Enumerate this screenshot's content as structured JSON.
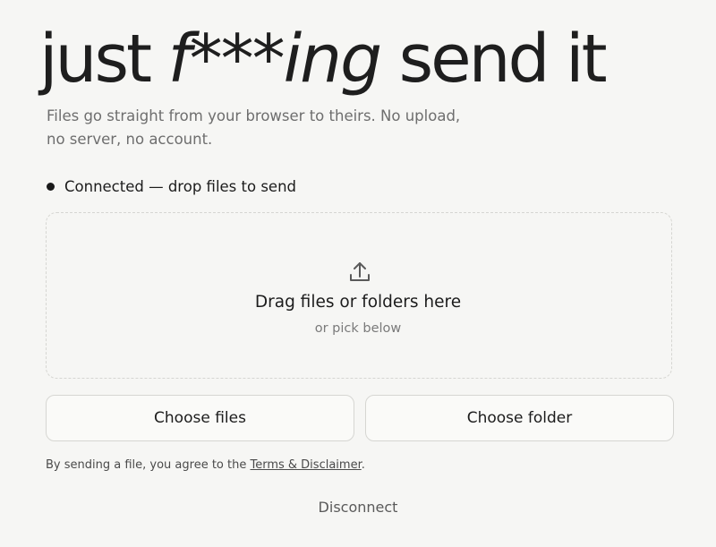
{
  "header": {
    "title_before": "just ",
    "title_em": "f***ing",
    "title_after": " send it",
    "tagline": "Files go straight from your browser to theirs. No upload, no server, no account."
  },
  "status": {
    "text": "Connected — drop files to send"
  },
  "dropzone": {
    "icon": "upload-icon",
    "heading": "Drag files or folders here",
    "subtext": "or pick below"
  },
  "actions": {
    "choose_files_label": "Choose files",
    "choose_folder_label": "Choose folder"
  },
  "legal": {
    "prefix": "By sending a file, you agree to the ",
    "link_label": "Terms & Disclaimer",
    "suffix": "."
  },
  "footer": {
    "disconnect_label": "Disconnect"
  },
  "colors": {
    "background": "#f6f6f4",
    "text": "#1c1c1c",
    "muted": "#6e6e6e",
    "border": "#d6d6d2"
  }
}
